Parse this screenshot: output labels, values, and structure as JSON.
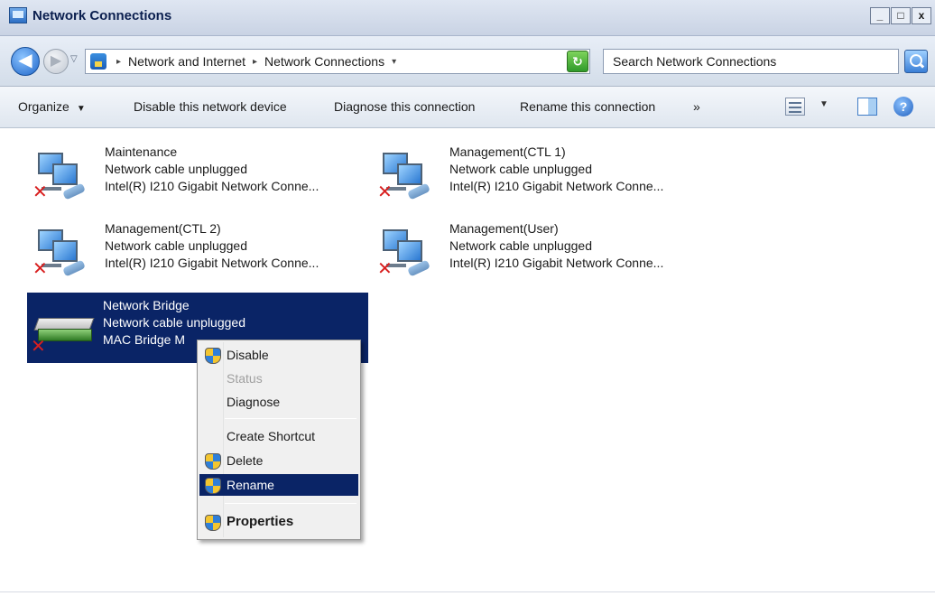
{
  "window": {
    "title": "Network Connections",
    "controls": [
      "_",
      "□",
      "x"
    ]
  },
  "address_bar": {
    "back": "◀",
    "forward": "▶",
    "breadcrumbs": [
      "Network and Internet",
      "Network Connections"
    ],
    "search_placeholder": "Search Network Connections"
  },
  "command_bar": {
    "items": [
      "Organize",
      "Disable this network device",
      "Diagnose this connection",
      "Rename this connection"
    ],
    "overflow": "»"
  },
  "connections": [
    {
      "name": "Maintenance",
      "status": "Network cable unplugged",
      "device": "Intel(R) I210 Gigabit Network Conne..."
    },
    {
      "name": "Management(CTL 1)",
      "status": "Network cable unplugged",
      "device": "Intel(R) I210 Gigabit Network Conne..."
    },
    {
      "name": "Management(CTL 2)",
      "status": "Network cable unplugged",
      "device": "Intel(R) I210 Gigabit Network Conne..."
    },
    {
      "name": "Management(User)",
      "status": "Network cable unplugged",
      "device": "Intel(R) I210 Gigabit Network Conne..."
    },
    {
      "name": "Network Bridge",
      "status": "Network cable unplugged",
      "device": "MAC Bridge M"
    }
  ],
  "context_menu": {
    "items": [
      "Disable",
      "Status",
      "Diagnose",
      "Create Shortcut",
      "Delete",
      "Rename",
      "Properties"
    ],
    "highlighted": "Rename",
    "disabled": [
      "Status"
    ]
  },
  "colors": {
    "selection": "#0a2466",
    "titlebar": "#c9d3e4"
  }
}
